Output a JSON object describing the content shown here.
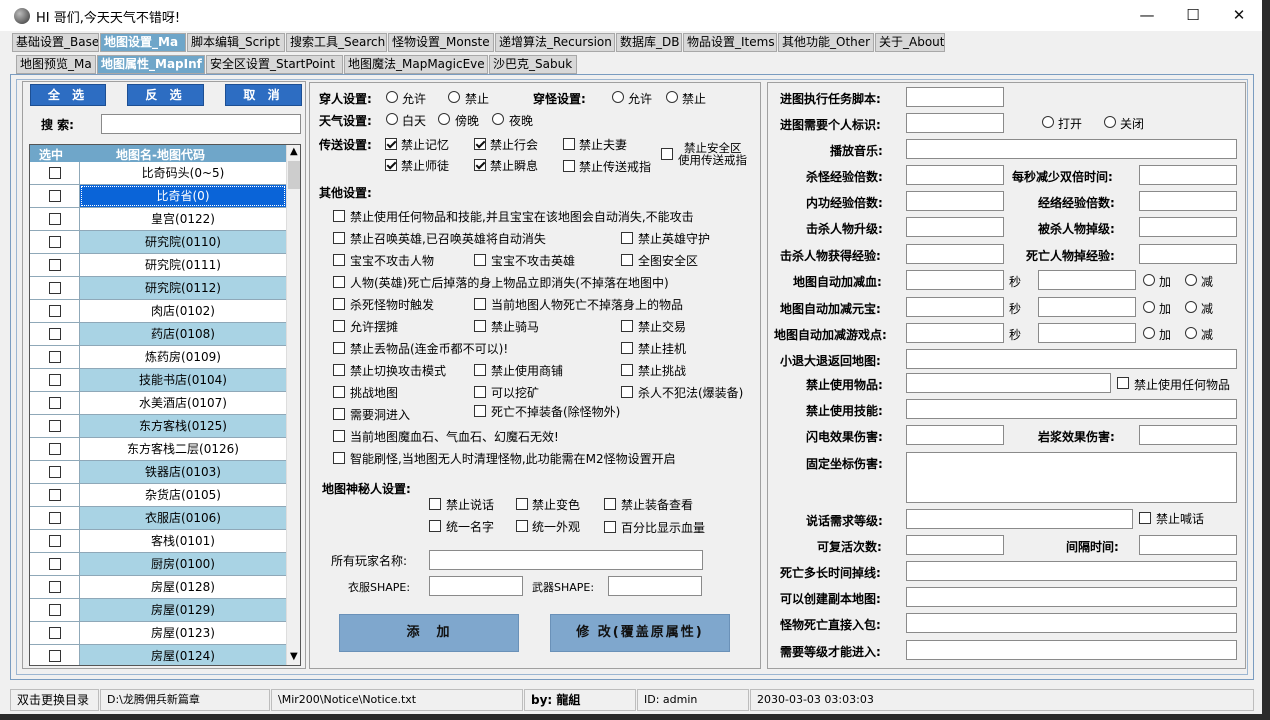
{
  "window": {
    "title": "HI 哥们,今天天气不错呀!",
    "minimize": "—",
    "maximize": "☐",
    "close": "✕"
  },
  "tabs1": [
    "基础设置_Base",
    "地图设置_Ma",
    "脚本编辑_Script",
    "搜索工具_Search",
    "怪物设置_Monste",
    "递增算法_Recursion",
    "数据库_DB",
    "物品设置_Items",
    "其他功能_Other",
    "关于_About"
  ],
  "tabs2": [
    "地图预览_Ma",
    "地图属性_MapInf",
    "安全区设置_StartPoint",
    "地图魔法_MapMagicEve",
    "沙巴克_Sabuk"
  ],
  "left": {
    "select_all": "全 选",
    "invert": "反 选",
    "cancel": "取 消",
    "search_label": "搜 索:",
    "search_value": "",
    "col_sel": "选中",
    "col_name": "地图名-地图代码",
    "rows": [
      "比奇码头(0~5)",
      "比奇省(0)",
      "皇宫(0122)",
      "研究院(0110)",
      "研究院(0111)",
      "研究院(0112)",
      "肉店(0102)",
      "药店(0108)",
      "炼药房(0109)",
      "技能书店(0104)",
      "水美酒店(0107)",
      "东方客栈(0125)",
      "东方客栈二层(0126)",
      "铁器店(0103)",
      "杂货店(0105)",
      "衣服店(0106)",
      "客栈(0101)",
      "厨房(0100)",
      "房屋(0128)",
      "房屋(0129)",
      "房屋(0123)",
      "房屋(0124)"
    ]
  },
  "mid": {
    "wear": "穿人设置:",
    "allow": "允许",
    "forbid": "禁止",
    "pass": "穿怪设置:",
    "weather": "天气设置:",
    "day": "白天",
    "dusk": "傍晚",
    "night": "夜晚",
    "tp": "传送设置:",
    "tp1": "禁止记忆",
    "tp2": "禁止行会",
    "tp3": "禁止夫妻",
    "tp4": "禁止安全区",
    "tp4b": "使用传送戒指",
    "tp5": "禁止师徒",
    "tp6": "禁止瞬息",
    "tp7": "禁止传送戒指",
    "other": "其他设置:",
    "o1": "禁止使用任何物品和技能,并且宝宝在该地图会自动消失,不能攻击",
    "o2": "禁止召唤英雄,已召唤英雄将自动消失",
    "o3": "禁止英雄守护",
    "o4": "宝宝不攻击人物",
    "o5": "宝宝不攻击英雄",
    "o6": "全图安全区",
    "o7": "人物(英雄)死亡后掉落的身上物品立即消失(不掉落在地图中)",
    "o8": "杀死怪物时触发",
    "o9": "当前地图人物死亡不掉落身上的物品",
    "o10": "允许摆摊",
    "o11": "禁止骑马",
    "o12": "禁止交易",
    "o13": "禁止丢物品(连金币都不可以)!",
    "o14": "禁止挂机",
    "o15": "禁止切换攻击模式",
    "o16": "禁止使用商铺",
    "o17": "禁止挑战",
    "o18": "挑战地图",
    "o19": "可以挖矿",
    "o20": "杀人不犯法(爆装备)",
    "o21": "需要洞进入",
    "o22": "死亡不掉装备(除怪物外)",
    "o23": "当前地图魔血石、气血石、幻魔石无效!",
    "o24": "智能刷怪,当地图无人时清理怪物,此功能需在M2怪物设置开启",
    "mystery": "地图神秘人设置:",
    "m1": "禁止说话",
    "m2": "禁止变色",
    "m3": "禁止装备查看",
    "m4": "统一名字",
    "m5": "统一外观",
    "m6": "百分比显示血量",
    "allname": "所有玩家名称:",
    "cloth": "衣服SHAPE:",
    "weapon": "武器SHAPE:",
    "add": "添　加",
    "modify": "修 改(覆盖原属性)"
  },
  "right": {
    "r1": "进图执行任务脚本:",
    "r2": "进图需要个人标识:",
    "open": "打开",
    "close": "关闭",
    "r3": "播放音乐:",
    "r4": "杀怪经验倍数:",
    "r4b": "每秒减少双倍时间:",
    "r5": "内功经验倍数:",
    "r5b": "经络经验倍数:",
    "r6": "击杀人物升级:",
    "r6b": "被杀人物掉级:",
    "r7": "击杀人物获得经验:",
    "r7b": "死亡人物掉经验:",
    "r8": "地图自动加减血:",
    "r9": "地图自动加减元宝:",
    "r10": "地图自动加减游戏点:",
    "sec": "秒",
    "plus": "加",
    "minus": "减",
    "r11": "小退大退返回地图:",
    "r12": "禁止使用物品:",
    "r12b": "禁止使用任何物品",
    "r13": "禁止使用技能:",
    "r14": "闪电效果伤害:",
    "r14b": "岩浆效果伤害:",
    "r15": "固定坐标伤害:",
    "r16": "说话需求等级:",
    "r16b": "禁止喊话",
    "r17": "可复活次数:",
    "r17b": "间隔时间:",
    "r18": "死亡多长时间掉线:",
    "r19": "可以创建副本地图:",
    "r20": "怪物死亡直接入包:",
    "r21": "需要等级才能进入:"
  },
  "status": {
    "s1": "双击更换目录",
    "s2": "D:\\龙腾佣兵新篇章",
    "s3": "\\Mir200\\Notice\\Notice.txt",
    "s4": "by: 龍組",
    "s5": "ID: admin",
    "s6": "2030-03-03 03:03:03"
  }
}
